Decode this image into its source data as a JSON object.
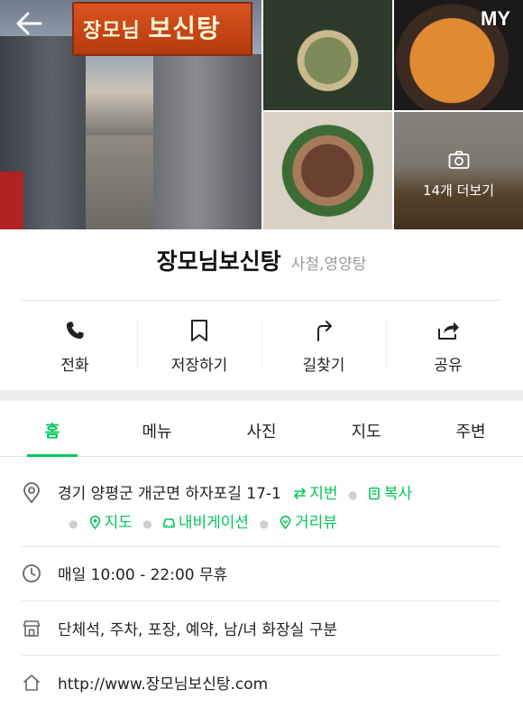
{
  "header": {
    "back_icon": "arrow-left-icon",
    "my_label": "MY",
    "sign_text_small": "장모님",
    "sign_text_big": "보신탕",
    "more_photos_label": "14개 더보기",
    "camera_icon": "camera-icon"
  },
  "place": {
    "name": "장모님보신탕",
    "category": "사철,영양탕"
  },
  "actions": [
    {
      "label": "전화",
      "icon": "phone-icon"
    },
    {
      "label": "저장하기",
      "icon": "bookmark-icon"
    },
    {
      "label": "길찾기",
      "icon": "directions-icon"
    },
    {
      "label": "공유",
      "icon": "share-icon"
    }
  ],
  "tabs": [
    {
      "label": "홈",
      "active": true
    },
    {
      "label": "메뉴",
      "active": false
    },
    {
      "label": "사진",
      "active": false
    },
    {
      "label": "지도",
      "active": false
    },
    {
      "label": "주변",
      "active": false
    }
  ],
  "info": {
    "address": "경기 양평군 개군면 하자포길 17-1",
    "jibun_label": "지번",
    "copy_label": "복사",
    "map_label": "지도",
    "navigation_label": "내비게이션",
    "streetview_label": "거리뷰",
    "hours": "매일 10:00 - 22:00 무휴",
    "amenities": "단체석, 주차, 포장, 예약, 남/녀 화장실 구분",
    "website": "http://www.장모님보신탕.com"
  },
  "colors": {
    "accent": "#03c75a",
    "category_gray": "#9a9a9a"
  }
}
